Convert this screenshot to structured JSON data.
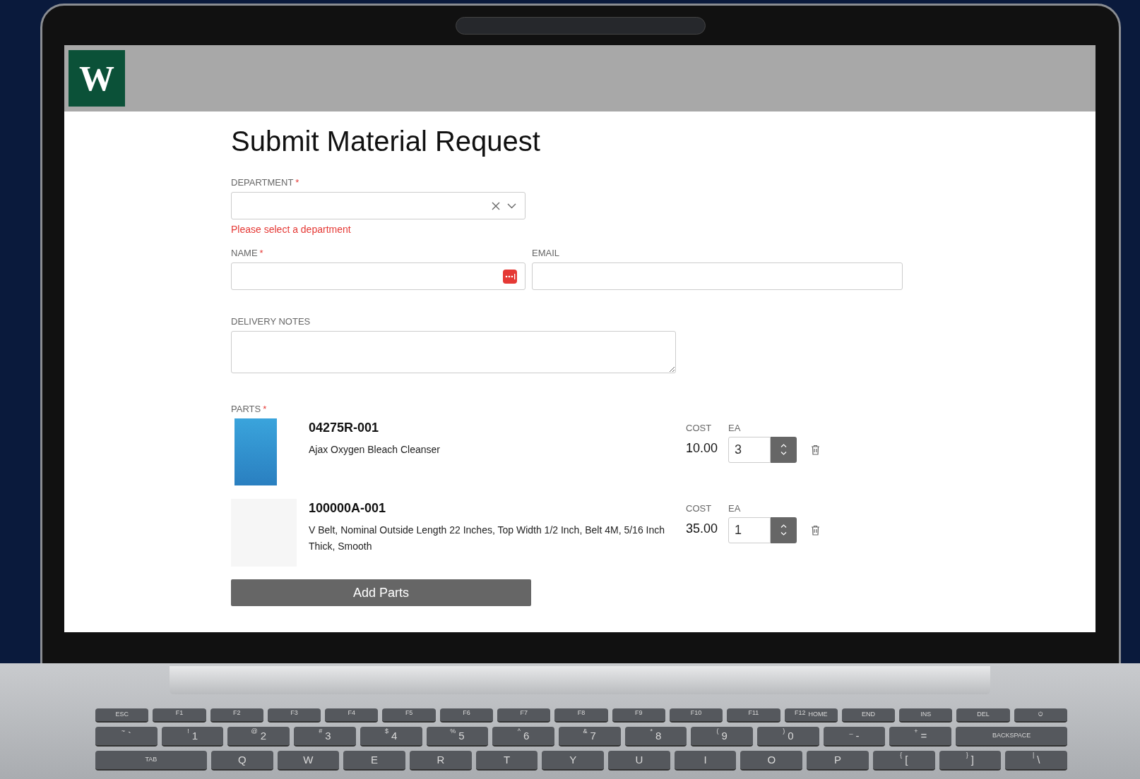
{
  "header": {
    "logo": "W"
  },
  "form": {
    "title": "Submit Material Request",
    "department": {
      "label": "DEPARTMENT",
      "required": true,
      "error": "Please select a department"
    },
    "name": {
      "label": "NAME",
      "required": true
    },
    "email": {
      "label": "EMAIL",
      "required": false
    },
    "notes": {
      "label": "DELIVERY NOTES",
      "required": false
    },
    "parts": {
      "label": "PARTS",
      "required": true,
      "items": [
        {
          "number": "04275R-001",
          "description": "Ajax Oxygen Bleach Cleanser",
          "cost_label": "COST",
          "cost": "10.00",
          "qty_label": "EA",
          "qty": "3",
          "kind": "tall"
        },
        {
          "number": "100000A-001",
          "description": "V Belt, Nominal Outside Length 22 Inches, Top Width 1/2 Inch, Belt 4M, 5/16 Inch Thick, Smooth",
          "cost_label": "COST",
          "cost": "35.00",
          "qty_label": "EA",
          "qty": "1",
          "kind": "wide"
        }
      ]
    },
    "add_button": "Add Parts"
  },
  "keyboard": {
    "rows": [
      [
        {
          "main": "ESC"
        },
        {
          "top": "F1"
        },
        {
          "top": "F2"
        },
        {
          "top": "F3"
        },
        {
          "top": "F4"
        },
        {
          "top": "F5"
        },
        {
          "top": "F6"
        },
        {
          "top": "F7"
        },
        {
          "top": "F8"
        },
        {
          "top": "F9"
        },
        {
          "top": "F10"
        },
        {
          "top": "F11"
        },
        {
          "top": "F12",
          "main": "HOME"
        },
        {
          "main": "END"
        },
        {
          "main": "INS"
        },
        {
          "main": "DEL"
        },
        {
          "main": "⏻"
        }
      ],
      [
        {
          "top": "~",
          "main": "`"
        },
        {
          "top": "!",
          "main": "1"
        },
        {
          "top": "@",
          "main": "2"
        },
        {
          "top": "#",
          "main": "3"
        },
        {
          "top": "$",
          "main": "4"
        },
        {
          "top": "%",
          "main": "5"
        },
        {
          "top": "^",
          "main": "6"
        },
        {
          "top": "&",
          "main": "7"
        },
        {
          "top": "*",
          "main": "8"
        },
        {
          "top": "(",
          "main": "9"
        },
        {
          "top": ")",
          "main": "0"
        },
        {
          "top": "_",
          "main": "-"
        },
        {
          "top": "+",
          "main": "="
        },
        {
          "main": "BACKSPACE"
        }
      ],
      [
        {
          "main": "TAB"
        },
        {
          "main": "Q"
        },
        {
          "main": "W"
        },
        {
          "main": "E"
        },
        {
          "main": "R"
        },
        {
          "main": "T"
        },
        {
          "main": "Y"
        },
        {
          "main": "U"
        },
        {
          "main": "I"
        },
        {
          "main": "O"
        },
        {
          "main": "P"
        },
        {
          "top": "{",
          "main": "["
        },
        {
          "top": "}",
          "main": "]"
        },
        {
          "top": "|",
          "main": "\\"
        }
      ]
    ]
  }
}
